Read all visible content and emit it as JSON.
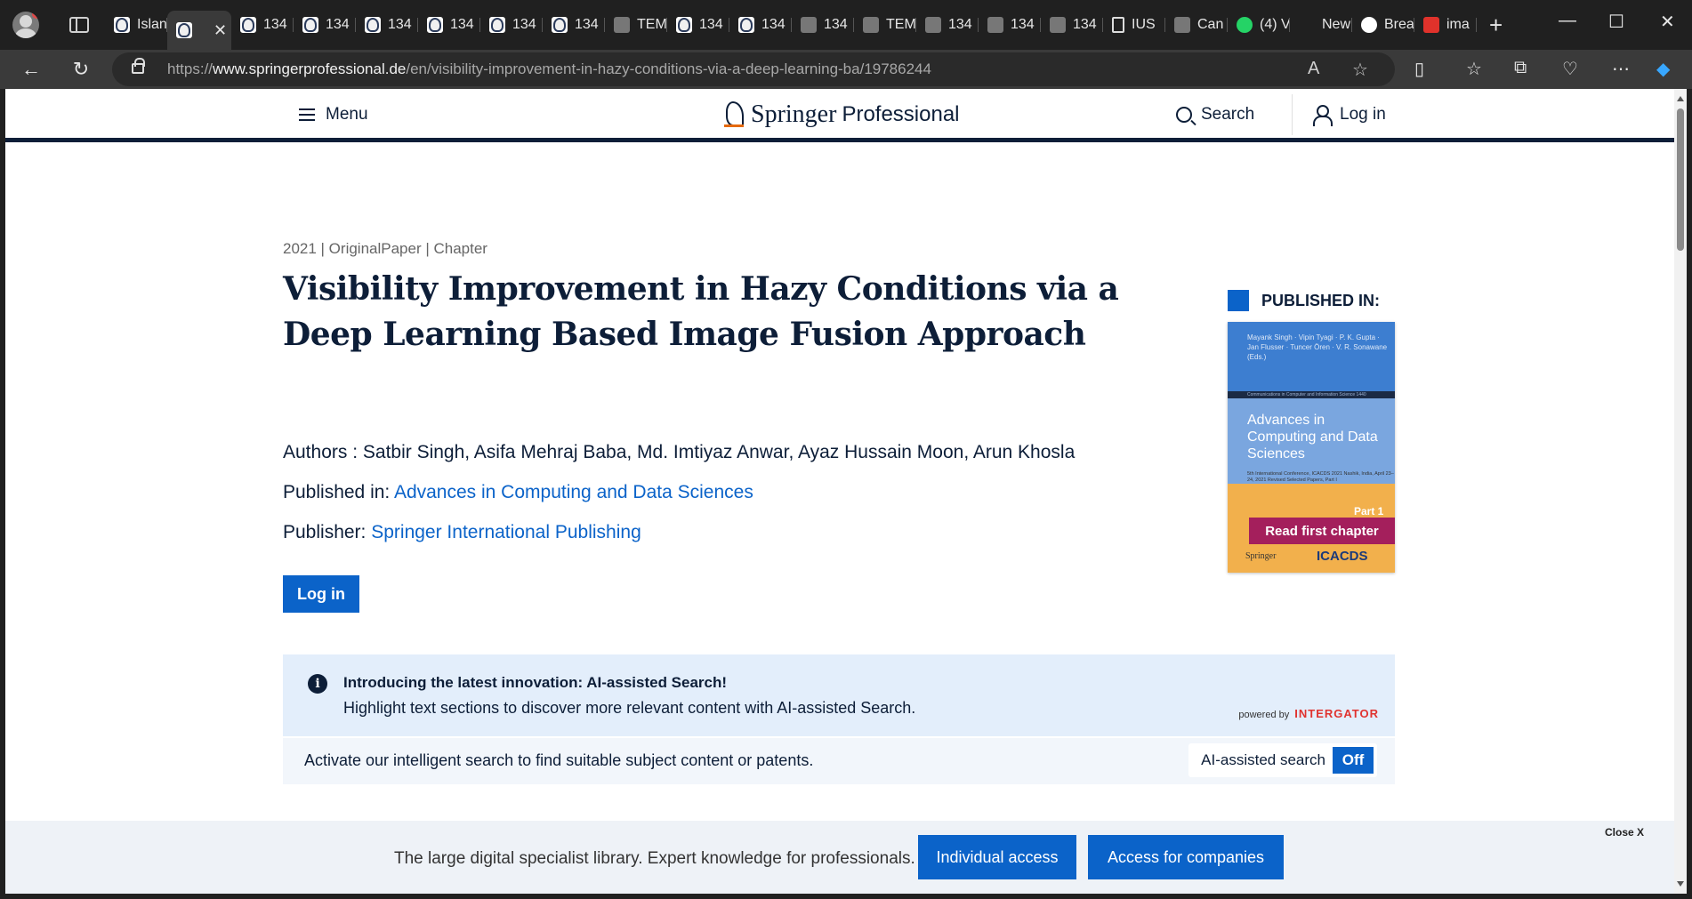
{
  "browser": {
    "tabs": [
      {
        "label": "Islan",
        "fav": "sp"
      },
      {
        "label": "",
        "fav": "sp",
        "active": true
      },
      {
        "label": "134",
        "fav": "sp"
      },
      {
        "label": "134",
        "fav": "sp"
      },
      {
        "label": "134",
        "fav": "sp"
      },
      {
        "label": "134",
        "fav": "sp"
      },
      {
        "label": "134",
        "fav": "sp"
      },
      {
        "label": "134",
        "fav": "sp"
      },
      {
        "label": "TEM",
        "fav": "tem"
      },
      {
        "label": "134",
        "fav": "sp"
      },
      {
        "label": "134",
        "fav": "sp"
      },
      {
        "label": "134",
        "fav": "tem"
      },
      {
        "label": "TEM",
        "fav": "tem"
      },
      {
        "label": "134",
        "fav": "tem"
      },
      {
        "label": "134",
        "fav": "tem"
      },
      {
        "label": "134",
        "fav": "tem"
      },
      {
        "label": "IUS",
        "fav": "doc"
      },
      {
        "label": "Can",
        "fav": "tem"
      },
      {
        "label": "(4) V",
        "fav": "wa"
      },
      {
        "label": "New",
        "fav": "gm"
      },
      {
        "label": "Brea",
        "fav": "gg"
      },
      {
        "label": "ima",
        "fav": "pdf"
      }
    ],
    "url_prefix": "https://",
    "url_host": "www.springerprofessional.de",
    "url_path": "/en/visibility-improvement-in-hazy-conditions-via-a-deep-learning-ba/19786244"
  },
  "header": {
    "menu_label": "Menu",
    "logo_springer": "Springer",
    "logo_pro": "Professional",
    "search_label": "Search",
    "login_label": "Log in"
  },
  "article": {
    "meta": "2021 | OriginalPaper | Chapter",
    "title": "Visibility Improvement in Hazy Conditions via a Deep Learning Based Image Fusion Approach",
    "authors_prefix": "Authors : ",
    "authors": "Satbir Singh, Asifa Mehraj Baba, Md. Imtiyaz Anwar, Ayaz Hussain Moon, Arun Khosla",
    "published_prefix": "Published in: ",
    "published_in": "Advances in Computing and Data Sciences",
    "publisher_prefix": "Publisher: ",
    "publisher": "Springer International Publishing",
    "login_button": "Log in"
  },
  "sidebar": {
    "published_in_label": "PUBLISHED IN:",
    "cover": {
      "authors": "Mayank Singh · Vipin Tyagi · P. K. Gupta · Jan Flusser · Tuncer Ören · V. R. Sonawane (Eds.)",
      "series": "Communications in Computer and Information Science 1440",
      "title": "Advances in Computing and Data Sciences",
      "subtitle": "5th International Conference, ICACDS 2021 Nashik, India, April 23–24, 2021 Revised Selected Papers, Part I",
      "part": "Part 1",
      "read_button": "Read first chapter",
      "publisher_mark": "Springer",
      "conf_mark": "ICACDS"
    }
  },
  "ai_search": {
    "heading": "Introducing the latest innovation: AI-assisted Search!",
    "description": "Highlight text sections to discover more relevant content with AI-assisted Search.",
    "powered_by": "powered by",
    "powered_brand": "INTERGATOR",
    "activate_text": "Activate our intelligent search to find suitable subject content or patents.",
    "toggle_label": "AI-assisted search",
    "toggle_state": "Off"
  },
  "banner": {
    "text": "The large digital specialist library. Expert knowledge for professionals.",
    "individual_button": "Individual access",
    "companies_button": "Access for companies",
    "close_label": "Close X"
  },
  "colors": {
    "navy": "#0d1e38",
    "link_blue": "#0b63c9",
    "read_chapter": "#a41f5c",
    "intergator_red": "#e0332f"
  }
}
